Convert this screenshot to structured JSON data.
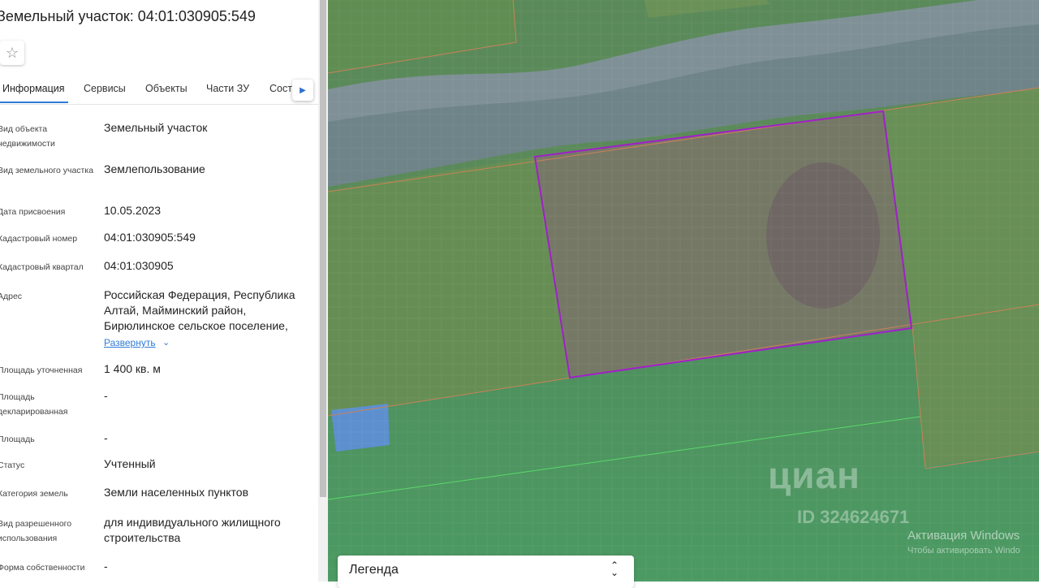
{
  "header": {
    "title": "Земельный участок: 04:01:030905:549",
    "favorite_icon": "star-icon"
  },
  "tabs": [
    {
      "label": "Информация",
      "active": true
    },
    {
      "label": "Сервисы"
    },
    {
      "label": "Объекты"
    },
    {
      "label": "Части ЗУ"
    },
    {
      "label": "Соста"
    }
  ],
  "tabs_scroll_icon": "chevron-right-icon",
  "fields": [
    {
      "label": "Вид объекта недвижимости",
      "value": "Земельный участок"
    },
    {
      "label": "Вид земельного участка",
      "value": "Землепользование"
    },
    {
      "label": "Дата присвоения",
      "value": "10.05.2023"
    },
    {
      "label": "Кадастровый номер",
      "value": "04:01:030905:549"
    },
    {
      "label": "Кадастровый квартал",
      "value": "04:01:030905"
    },
    {
      "label": "Адрес",
      "value": "Российская Федерация, Республика Алтай, Майминский район, Бирюлинское сельское поселение,"
    },
    {
      "label": "Площадь уточненная",
      "value": "1 400 кв. м"
    },
    {
      "label": "Площадь декларированная",
      "value": "-"
    },
    {
      "label": "Площадь",
      "value": "-"
    },
    {
      "label": "Статус",
      "value": "Учтенный"
    },
    {
      "label": "Категория земель",
      "value": "Земли населенных пунктов"
    },
    {
      "label": "Вид разрешенного использования",
      "value": "для индивидуального жилищного строительства"
    },
    {
      "label": "Форма собственности",
      "value": "-"
    }
  ],
  "address_expand": "Развернуть",
  "legend": {
    "label": "Легенда"
  },
  "watermark": {
    "brand": "циан",
    "id": "ID 324624671"
  },
  "windows_activation": {
    "line1": "Активация Windows",
    "line2": "Чтобы активировать Windo"
  },
  "colors": {
    "accent": "#2f7bd8",
    "parcel_outline": "#a020c8",
    "boundary": "#c9825a",
    "green_line": "#5bd86a"
  }
}
